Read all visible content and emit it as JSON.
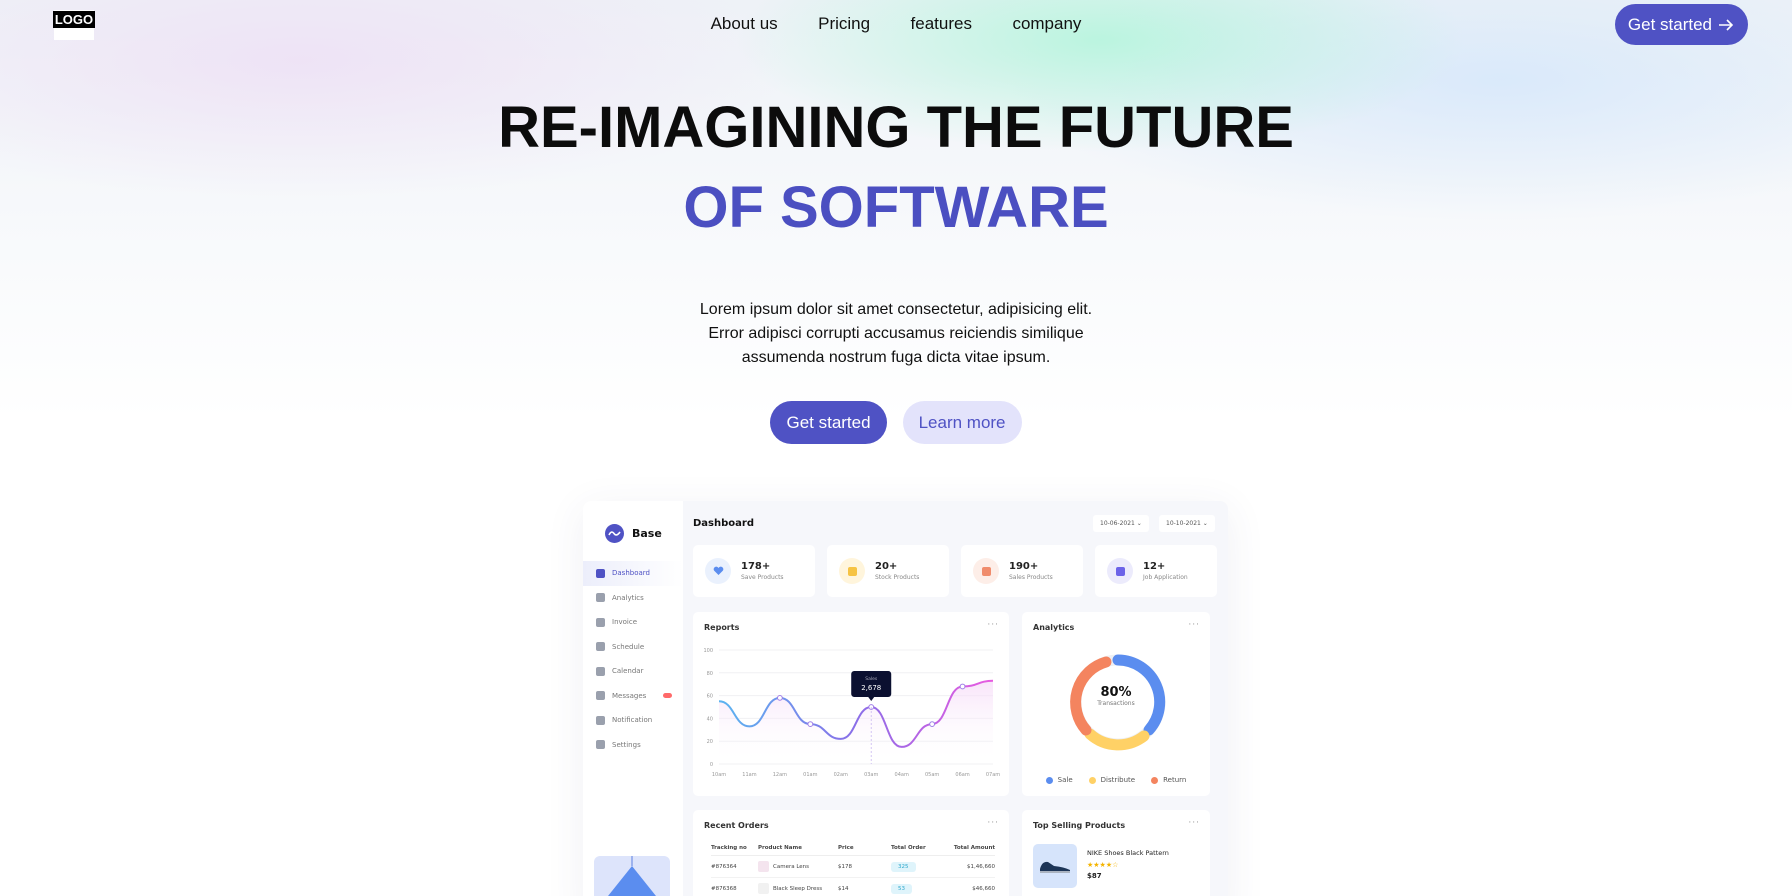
{
  "nav": {
    "logo": "LOGO",
    "links": [
      "About us",
      "Pricing",
      "features",
      "company"
    ],
    "cta_label": "Get started"
  },
  "hero": {
    "title_line1": "RE-IMAGINING THE FUTURE",
    "title_line2": "OF SOFTWARE",
    "description": "Lorem ipsum dolor sit amet consectetur, adipisicing elit. Error adipisci corrupti accusamus reiciendis similique assumenda nostrum fuga dicta vitae ipsum.",
    "primary_label": "Get started",
    "secondary_label": "Learn more"
  },
  "colors": {
    "accent": "#4f52c4",
    "accent_light": "#e3e3fb"
  },
  "dashboard": {
    "brand": "Base",
    "menu": [
      {
        "label": "Dashboard",
        "active": true,
        "icon": "grid-icon"
      },
      {
        "label": "Analytics",
        "icon": "analytics-icon"
      },
      {
        "label": "Invoice",
        "icon": "invoice-icon"
      },
      {
        "label": "Schedule",
        "icon": "schedule-icon"
      },
      {
        "label": "Calendar",
        "icon": "calendar-icon"
      },
      {
        "label": "Messages",
        "icon": "messages-icon",
        "badge": true
      },
      {
        "label": "Notification",
        "icon": "bell-icon"
      },
      {
        "label": "Settings",
        "icon": "gear-icon"
      }
    ],
    "title": "Dashboard",
    "date_from": "10-06-2021",
    "date_to": "10-10-2021",
    "stats": [
      {
        "value": "178+",
        "label": "Save Products",
        "color": "#5b8def",
        "bg": "#eaf1fd"
      },
      {
        "value": "20+",
        "label": "Stock Products",
        "color": "#f6c343",
        "bg": "#fff5dc"
      },
      {
        "value": "190+",
        "label": "Sales Products",
        "color": "#f08c6c",
        "bg": "#fdeee8"
      },
      {
        "value": "12+",
        "label": "Job Application",
        "color": "#6c63e8",
        "bg": "#ecebfc"
      }
    ],
    "reports": {
      "title": "Reports",
      "tooltip_label": "Sales",
      "tooltip_value": "2,678"
    },
    "analytics": {
      "title": "Analytics",
      "percent": "80%",
      "caption": "Transactions",
      "legend": [
        {
          "label": "Sale",
          "color": "#5b8def"
        },
        {
          "label": "Distribute",
          "color": "#ffd166"
        },
        {
          "label": "Return",
          "color": "#f4845f"
        }
      ]
    },
    "orders": {
      "title": "Recent Orders",
      "columns": [
        "Tracking no",
        "Product Name",
        "Price",
        "Total Order",
        "Total Amount"
      ],
      "rows": [
        [
          "#876364",
          "Camera Lens",
          "$178",
          "325",
          "$1,46,660"
        ],
        [
          "#876368",
          "Black Sleep Dress",
          "$14",
          "53",
          "$46,660"
        ]
      ]
    },
    "top_products": {
      "title": "Top Selling Products",
      "name": "NIKE Shoes Black Pattern",
      "stars": "★★★★☆",
      "price": "$87"
    }
  },
  "chart_data": {
    "type": "line",
    "title": "Reports",
    "x": [
      "10am",
      "11am",
      "12am",
      "01am",
      "02am",
      "03am",
      "04am",
      "05am",
      "06am",
      "07am"
    ],
    "series": [
      {
        "values": [
          55,
          33,
          58,
          35,
          22,
          50,
          15,
          35,
          68,
          73
        ]
      }
    ],
    "yticks": [
      0,
      20,
      40,
      60,
      80,
      100
    ],
    "ylim": [
      0,
      100
    ],
    "grid": true
  }
}
